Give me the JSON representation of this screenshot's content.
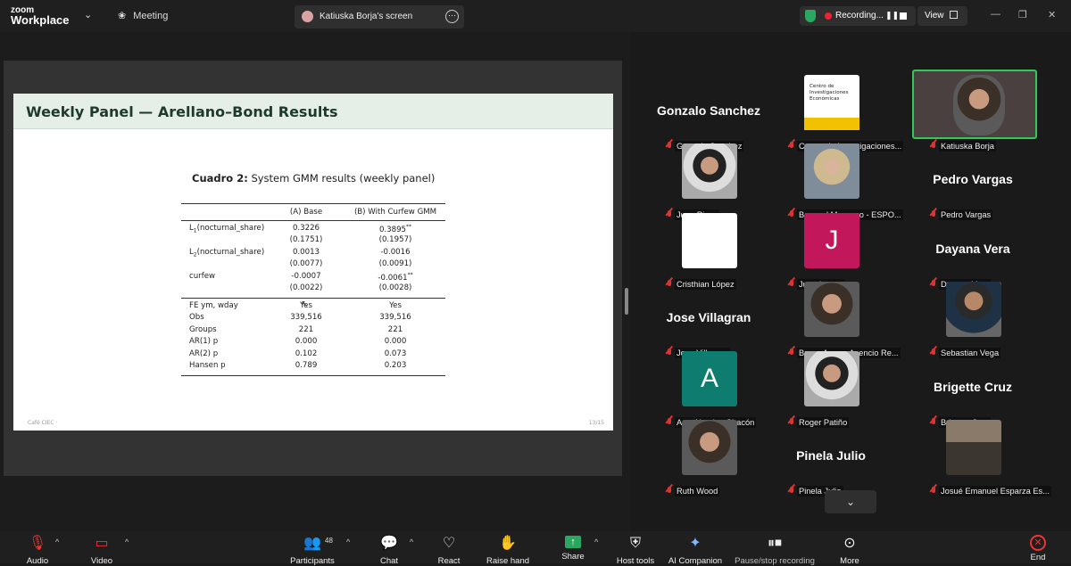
{
  "app": {
    "logo_top": "zoom",
    "logo_bottom": "Workplace",
    "meeting_label": "Meeting"
  },
  "share_tab": {
    "label": "Katiuska Borja's screen"
  },
  "recording": {
    "label": "Recording..."
  },
  "view_label": "View",
  "slide": {
    "title": "Weekly Panel — Arellano–Bond Results",
    "caption_bold": "Cuadro 2:",
    "caption_text": "System GMM results (weekly panel)",
    "headers": [
      "",
      "(A) Base",
      "(B) With Curfew GMM"
    ],
    "rows": [
      [
        "L1(nocturnal_share)",
        "0.3226",
        "0.3895**"
      ],
      [
        "",
        "(0.1751)",
        "(0.1957)"
      ],
      [
        "L2(nocturnal_share)",
        "0.0013",
        "-0.0016"
      ],
      [
        "",
        "(0.0077)",
        "(0.0091)"
      ],
      [
        "curfew",
        "-0.0007",
        "-0.0061**"
      ],
      [
        "",
        "(0.0022)",
        "(0.0028)"
      ]
    ],
    "stats": [
      [
        "FE ym, wday",
        "Yes",
        "Yes"
      ],
      [
        "Obs",
        "339,516",
        "339,516"
      ],
      [
        "Groups",
        "221",
        "221"
      ],
      [
        "AR(1) p",
        "0.000",
        "0.000"
      ],
      [
        "AR(2) p",
        "0.102",
        "0.073"
      ],
      [
        "Hansen p",
        "0.789",
        "0.203"
      ]
    ],
    "footer_left": "Café CIEC ·",
    "footer_right": "13/15"
  },
  "participants": [
    {
      "name": "Gonzalo Sanchez",
      "display": "Gonzalo Sanchez",
      "kind": "name"
    },
    {
      "name": "Centro de Investigaciones...",
      "kind": "logo",
      "logo_text": "Centro de\nInvestigaciones\nEconómicas"
    },
    {
      "name": "Katiuska Borja",
      "kind": "active"
    },
    {
      "name": "Juan Rizzo",
      "kind": "photo"
    },
    {
      "name": "Bernard Moscoso - ESPO...",
      "kind": "photo"
    },
    {
      "name": "Pedro Vargas",
      "display": "Pedro Vargas",
      "kind": "name"
    },
    {
      "name": "Cristhian López",
      "kind": "blank"
    },
    {
      "name": "Juan Larrea",
      "kind": "letter",
      "letter": "J",
      "color": "#c2185b"
    },
    {
      "name": "Dayana Vera",
      "display": "Dayana Vera",
      "kind": "name"
    },
    {
      "name": "Jose Villagran",
      "display": "Jose Villagran",
      "kind": "name"
    },
    {
      "name": "Bruno Aarom Asencio Re...",
      "kind": "photo"
    },
    {
      "name": "Sebastian Vega",
      "kind": "photo"
    },
    {
      "name": "Amy Narcisa Chacón",
      "kind": "letter",
      "letter": "A",
      "color": "#0e7c6f"
    },
    {
      "name": "Roger Patiño",
      "kind": "photo"
    },
    {
      "name": "Brigette Cruz",
      "display": "Brigette Cruz",
      "kind": "name"
    },
    {
      "name": "Ruth Wood",
      "kind": "photo"
    },
    {
      "name": "Pinela Julio",
      "display": "Pinela Julio",
      "kind": "name"
    },
    {
      "name": "Josué Emanuel Esparza Es...",
      "kind": "photo"
    }
  ],
  "pager_glyph": "⌄",
  "toolbar": {
    "audio": "Audio",
    "video": "Video",
    "participants": "Participants",
    "participants_count": "48",
    "chat": "Chat",
    "react": "React",
    "raise_hand": "Raise hand",
    "share": "Share",
    "host_tools": "Host tools",
    "ai_companion": "AI Companion",
    "pause_rec": "Pause/stop recording",
    "more": "More",
    "end": "End"
  }
}
